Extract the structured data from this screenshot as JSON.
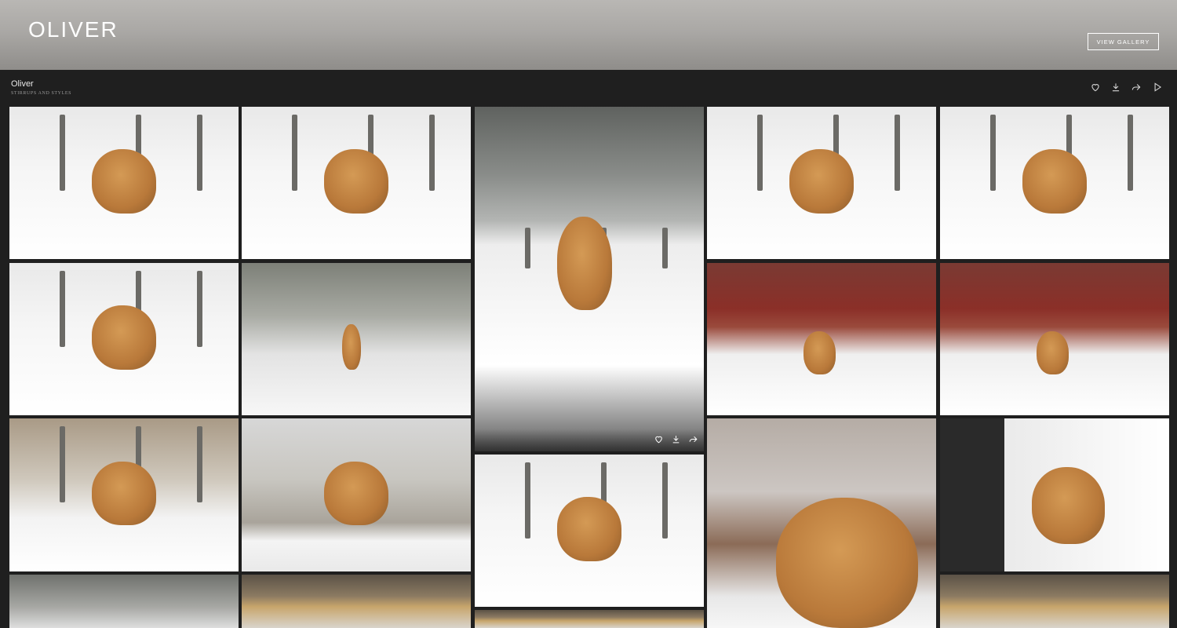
{
  "hero": {
    "title": "OLIVER",
    "view_button": "VIEW GALLERY"
  },
  "gallery": {
    "title": "Oliver",
    "subtitle": "STIRRUPS AND STYLES"
  },
  "toolbar_icons": [
    "heart-icon",
    "download-icon",
    "share-icon",
    "play-icon"
  ],
  "hover_icons": [
    "heart-icon",
    "download-icon",
    "share-icon"
  ],
  "photo_alt": "Oliver photo",
  "colors": {
    "background": "#1f1f1f",
    "snow": "#f4f4f4",
    "dog": "#c88a47",
    "barn": "#8b2a24",
    "text": "#e8e8e8"
  }
}
